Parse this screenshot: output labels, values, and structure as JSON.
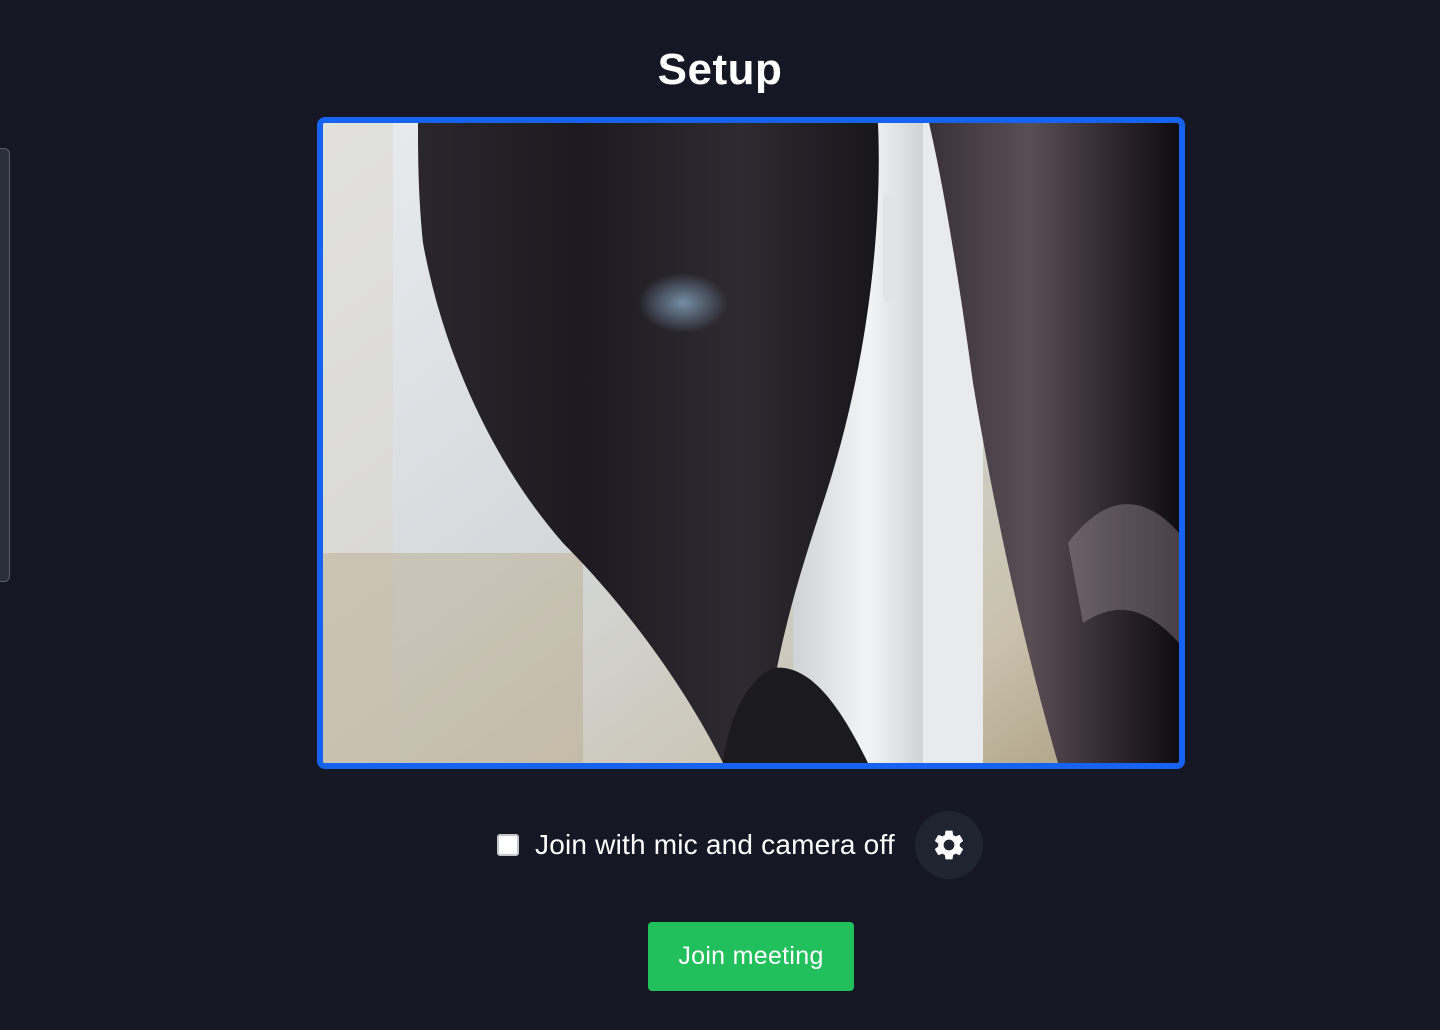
{
  "page": {
    "title": "Setup"
  },
  "preview": {
    "border_color": "#1663f2"
  },
  "options": {
    "mute_checkbox_checked": false,
    "mute_checkbox_label": "Join with mic and camera off",
    "settings_icon": "gear-icon"
  },
  "actions": {
    "join_label": "Join meeting",
    "join_color": "#21c05c"
  },
  "colors": {
    "background": "#151724"
  }
}
